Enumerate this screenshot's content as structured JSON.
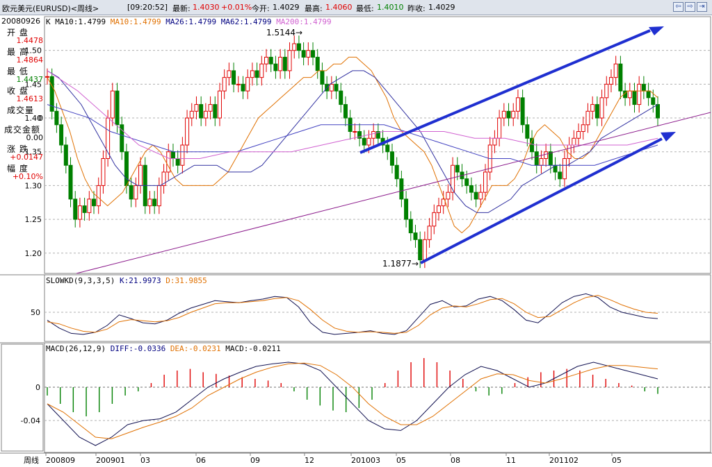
{
  "titlebar": {
    "symbol": "欧元美元(EURUSD)<周线>",
    "time": "[09:20:52]",
    "latest_label": "最新:",
    "latest_value": "1.4030",
    "change": "+0.01%",
    "open_label": "今开:",
    "open_value": "1.4029",
    "high_label": "最高:",
    "high_value": "1.4060",
    "low_label": "最低:",
    "low_value": "1.4010",
    "prev_label": "昨收:",
    "prev_value": "1.4029",
    "nav_buttons": [
      "⇦",
      "⇨",
      "⇥"
    ]
  },
  "info_panel": {
    "date": "20080926",
    "open_label": "开  盘",
    "open": "1.4478",
    "high_label": "最  高",
    "high": "1.4864",
    "low_label": "最  低",
    "low": "1.4437",
    "close_label": "收  盘",
    "close": "1.4613",
    "volume_label": "成交量",
    "volume": "0",
    "amount_label": "成交金额",
    "amount": "0.00",
    "change_label": "涨  跌",
    "change_value": "+0.0147",
    "pct_label": "幅  度",
    "pct": "+0.10%"
  },
  "legend": {
    "price": [
      {
        "text": "K",
        "color": "#000000"
      },
      {
        "text": "MA10:1.4799",
        "color": "#000000"
      },
      {
        "text": "MA10:1.4799",
        "color": "#e07000"
      },
      {
        "text": "MA26:1.4799",
        "color": "#000080"
      },
      {
        "text": "MA62:1.4799",
        "color": "#000080"
      },
      {
        "text": "MA200:1.4799",
        "color": "#d060d0"
      }
    ],
    "kd": [
      {
        "text": "SLOWKD(9,3,3,5)",
        "color": "#000000"
      },
      {
        "text": "K:21.9973",
        "color": "#000080"
      },
      {
        "text": "D:31.9855",
        "color": "#e07000"
      }
    ],
    "macd": [
      {
        "text": "MACD(26,12,9)",
        "color": "#000000"
      },
      {
        "text": "DIFF:-0.0336",
        "color": "#000080"
      },
      {
        "text": "DEA:-0.0231",
        "color": "#e07000"
      },
      {
        "text": "MACD:-0.0211",
        "color": "#000000"
      }
    ]
  },
  "chart_data": {
    "type": "line",
    "x_axis_label": "周线",
    "x_ticks": [
      "200809",
      "200901",
      "03",
      "06",
      "09",
      "12",
      "201003",
      "05",
      "08",
      "11",
      "201102",
      "05"
    ],
    "price_ticks": [
      "1.50",
      "1.45",
      "1.40",
      "1.35",
      "1.30",
      "1.25",
      "1.20"
    ],
    "price_ylim": [
      1.17,
      1.55
    ],
    "annotations": [
      {
        "text": "1.5144",
        "x": "200911",
        "y": 1.5144
      },
      {
        "text": "1.1877",
        "x": "201006",
        "y": 1.1877
      }
    ],
    "close_series": [
      1.4613,
      1.41,
      1.39,
      1.36,
      1.33,
      1.28,
      1.25,
      1.27,
      1.26,
      1.28,
      1.27,
      1.3,
      1.34,
      1.4,
      1.44,
      1.39,
      1.35,
      1.3,
      1.28,
      1.3,
      1.33,
      1.27,
      1.28,
      1.27,
      1.3,
      1.32,
      1.35,
      1.34,
      1.33,
      1.36,
      1.4,
      1.41,
      1.42,
      1.4,
      1.41,
      1.42,
      1.4,
      1.44,
      1.46,
      1.47,
      1.45,
      1.45,
      1.44,
      1.46,
      1.47,
      1.46,
      1.48,
      1.49,
      1.48,
      1.47,
      1.49,
      1.47,
      1.5,
      1.51,
      1.5,
      1.49,
      1.5,
      1.49,
      1.47,
      1.45,
      1.44,
      1.45,
      1.44,
      1.42,
      1.4,
      1.38,
      1.38,
      1.37,
      1.36,
      1.37,
      1.38,
      1.37,
      1.36,
      1.35,
      1.33,
      1.31,
      1.28,
      1.25,
      1.23,
      1.22,
      1.19,
      1.22,
      1.24,
      1.26,
      1.27,
      1.28,
      1.29,
      1.33,
      1.32,
      1.31,
      1.3,
      1.29,
      1.28,
      1.29,
      1.32,
      1.36,
      1.37,
      1.4,
      1.41,
      1.4,
      1.41,
      1.43,
      1.39,
      1.37,
      1.35,
      1.33,
      1.34,
      1.35,
      1.33,
      1.32,
      1.31,
      1.34,
      1.36,
      1.37,
      1.38,
      1.39,
      1.41,
      1.42,
      1.4,
      1.43,
      1.45,
      1.46,
      1.48,
      1.44,
      1.43,
      1.44,
      1.42,
      1.45,
      1.44,
      1.43,
      1.42,
      1.4
    ],
    "ma_fast": [
      1.46,
      1.44,
      1.41,
      1.38,
      1.34,
      1.31,
      1.29,
      1.28,
      1.27,
      1.28,
      1.29,
      1.31,
      1.33,
      1.35,
      1.36,
      1.35,
      1.33,
      1.31,
      1.3,
      1.3,
      1.3,
      1.3,
      1.3,
      1.31,
      1.32,
      1.34,
      1.36,
      1.38,
      1.4,
      1.41,
      1.42,
      1.43,
      1.44,
      1.45,
      1.46,
      1.46,
      1.47,
      1.47,
      1.48,
      1.48,
      1.49,
      1.49,
      1.48,
      1.47,
      1.45,
      1.43,
      1.4,
      1.38,
      1.37,
      1.36,
      1.35,
      1.33,
      1.3,
      1.27,
      1.24,
      1.23,
      1.24,
      1.26,
      1.28,
      1.3,
      1.3,
      1.3,
      1.31,
      1.33,
      1.36,
      1.38,
      1.39,
      1.38,
      1.37,
      1.35,
      1.34,
      1.34,
      1.35,
      1.37,
      1.39,
      1.41,
      1.43,
      1.44,
      1.44,
      1.44,
      1.44,
      1.43
    ],
    "ma_mid": [
      1.47,
      1.46,
      1.44,
      1.42,
      1.39,
      1.36,
      1.33,
      1.31,
      1.3,
      1.3,
      1.3,
      1.31,
      1.32,
      1.33,
      1.33,
      1.33,
      1.32,
      1.32,
      1.32,
      1.33,
      1.35,
      1.37,
      1.39,
      1.41,
      1.43,
      1.45,
      1.46,
      1.47,
      1.47,
      1.46,
      1.44,
      1.42,
      1.4,
      1.38,
      1.35,
      1.32,
      1.29,
      1.27,
      1.26,
      1.26,
      1.27,
      1.28,
      1.3,
      1.31,
      1.32,
      1.33,
      1.33,
      1.34,
      1.35,
      1.37,
      1.38,
      1.39,
      1.4,
      1.41,
      1.42
    ],
    "ma_slow": [
      1.42,
      1.41,
      1.4,
      1.38,
      1.37,
      1.36,
      1.35,
      1.35,
      1.35,
      1.35,
      1.36,
      1.37,
      1.38,
      1.39,
      1.39,
      1.39,
      1.39,
      1.38,
      1.37,
      1.36,
      1.35,
      1.34,
      1.34,
      1.33,
      1.33,
      1.33,
      1.33,
      1.34,
      1.35,
      1.36
    ],
    "ma200": [
      1.47,
      1.44,
      1.4,
      1.36,
      1.34,
      1.34,
      1.35,
      1.35,
      1.35,
      1.36,
      1.37,
      1.38,
      1.38,
      1.38,
      1.37,
      1.37,
      1.36,
      1.36,
      1.36,
      1.36,
      1.37
    ],
    "kd_ticks": [
      "50"
    ],
    "kd_ylim": [
      0,
      100
    ],
    "k_series": [
      35,
      20,
      10,
      8,
      12,
      25,
      45,
      38,
      30,
      28,
      35,
      48,
      58,
      65,
      72,
      70,
      68,
      72,
      75,
      80,
      78,
      60,
      30,
      12,
      8,
      10,
      12,
      15,
      10,
      8,
      15,
      40,
      65,
      72,
      60,
      62,
      75,
      80,
      72,
      55,
      35,
      30,
      48,
      68,
      80,
      85,
      78,
      60,
      50,
      45,
      40,
      38
    ],
    "d_series": [
      32,
      28,
      20,
      14,
      12,
      18,
      32,
      36,
      34,
      32,
      34,
      40,
      50,
      58,
      66,
      68,
      68,
      70,
      72,
      76,
      78,
      72,
      55,
      35,
      20,
      14,
      12,
      13,
      12,
      10,
      12,
      25,
      45,
      58,
      62,
      60,
      66,
      74,
      76,
      66,
      50,
      40,
      42,
      55,
      68,
      78,
      82,
      74,
      64,
      56,
      50,
      48
    ],
    "macd_ticks": [
      "0",
      "-0.04"
    ],
    "macd_ylim": [
      -0.075,
      0.04
    ],
    "diff_series": [
      -0.02,
      -0.04,
      -0.06,
      -0.07,
      -0.06,
      -0.045,
      -0.04,
      -0.038,
      -0.03,
      -0.015,
      0.0,
      0.01,
      0.018,
      0.025,
      0.028,
      0.03,
      0.028,
      0.02,
      0.0,
      -0.02,
      -0.04,
      -0.05,
      -0.052,
      -0.04,
      -0.02,
      0.0,
      0.015,
      0.025,
      0.02,
      0.01,
      0.0,
      0.005,
      0.015,
      0.025,
      0.03,
      0.025,
      0.02,
      0.015,
      0.01
    ],
    "dea_series": [
      -0.02,
      -0.03,
      -0.045,
      -0.06,
      -0.062,
      -0.055,
      -0.048,
      -0.042,
      -0.035,
      -0.025,
      -0.01,
      0.0,
      0.01,
      0.018,
      0.024,
      0.028,
      0.029,
      0.026,
      0.015,
      0.0,
      -0.02,
      -0.035,
      -0.045,
      -0.045,
      -0.035,
      -0.02,
      -0.005,
      0.01,
      0.016,
      0.015,
      0.008,
      0.005,
      0.01,
      0.016,
      0.022,
      0.026,
      0.026,
      0.024,
      0.022
    ],
    "macd_hist": [
      -0.01,
      -0.02,
      -0.03,
      -0.035,
      -0.03,
      -0.02,
      -0.01,
      -0.005,
      0.005,
      0.015,
      0.02,
      0.022,
      0.018,
      0.016,
      0.014,
      0.012,
      0.01,
      0.008,
      0.005,
      -0.005,
      -0.015,
      -0.022,
      -0.028,
      -0.03,
      -0.025,
      -0.015,
      0.005,
      0.02,
      0.03,
      0.035,
      0.03,
      0.02,
      0.01,
      -0.005,
      -0.01,
      -0.008,
      0.005,
      0.012,
      0.018,
      0.02,
      0.022,
      0.02,
      0.015,
      0.01,
      0.005,
      0.002,
      -0.005,
      -0.008
    ]
  }
}
